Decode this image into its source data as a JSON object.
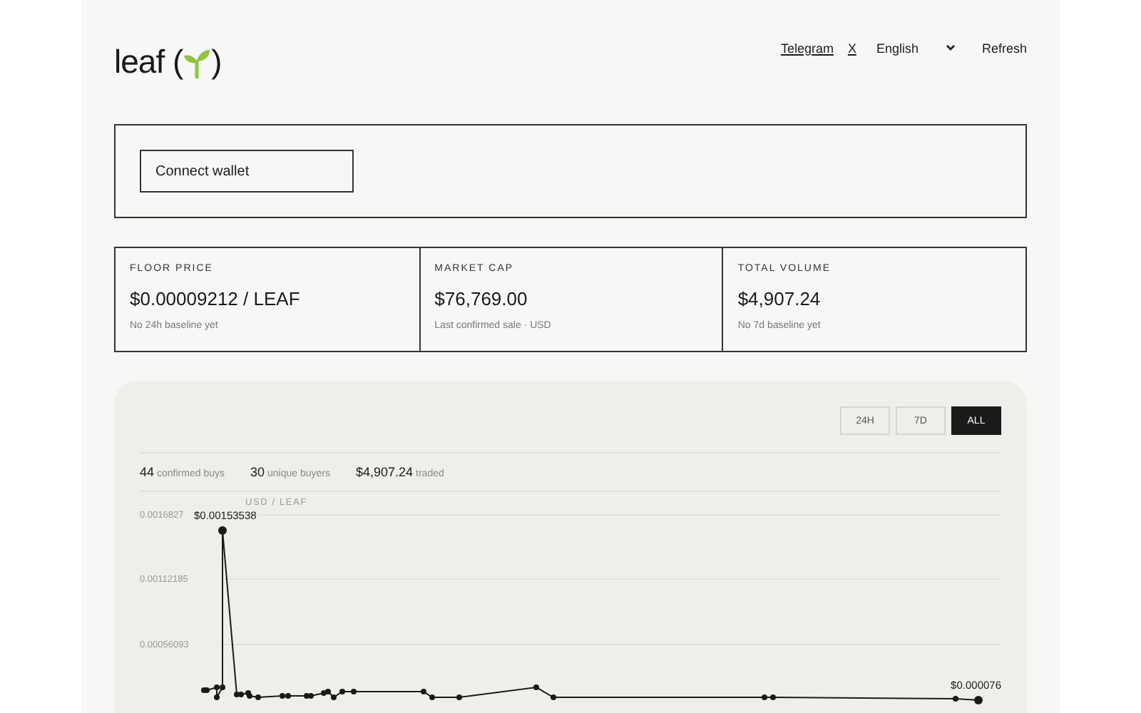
{
  "header": {
    "logo": "leaf (",
    "logo_close": ")",
    "links": [
      "Telegram",
      "X"
    ],
    "language": "English",
    "refresh": "Refresh"
  },
  "wallet": {
    "button": "Connect wallet"
  },
  "stats": [
    {
      "label": "FLOOR PRICE",
      "value": "$0.00009212 / LEAF",
      "note": "No 24h baseline yet"
    },
    {
      "label": "MARKET CAP",
      "value": "$76,769.00",
      "note": "Last confirmed sale · USD"
    },
    {
      "label": "TOTAL VOLUME",
      "value": "$4,907.24",
      "note": "No 7d baseline yet"
    }
  ],
  "ranges": [
    {
      "label": "24H",
      "selected": false
    },
    {
      "label": "7D",
      "selected": false
    },
    {
      "label": "ALL",
      "selected": true
    }
  ],
  "summary": [
    {
      "value": "44",
      "label": "confirmed buys"
    },
    {
      "value": "30",
      "label": "unique buyers"
    },
    {
      "value": "$4,907.24",
      "label": "traded"
    }
  ],
  "chart": {
    "unit": "USD / LEAF",
    "y_labels": [
      "0.0016827",
      "0.00112185",
      "0.00056093"
    ],
    "peak_label": "$0.00153538",
    "last_label": "$0.000076"
  }
}
